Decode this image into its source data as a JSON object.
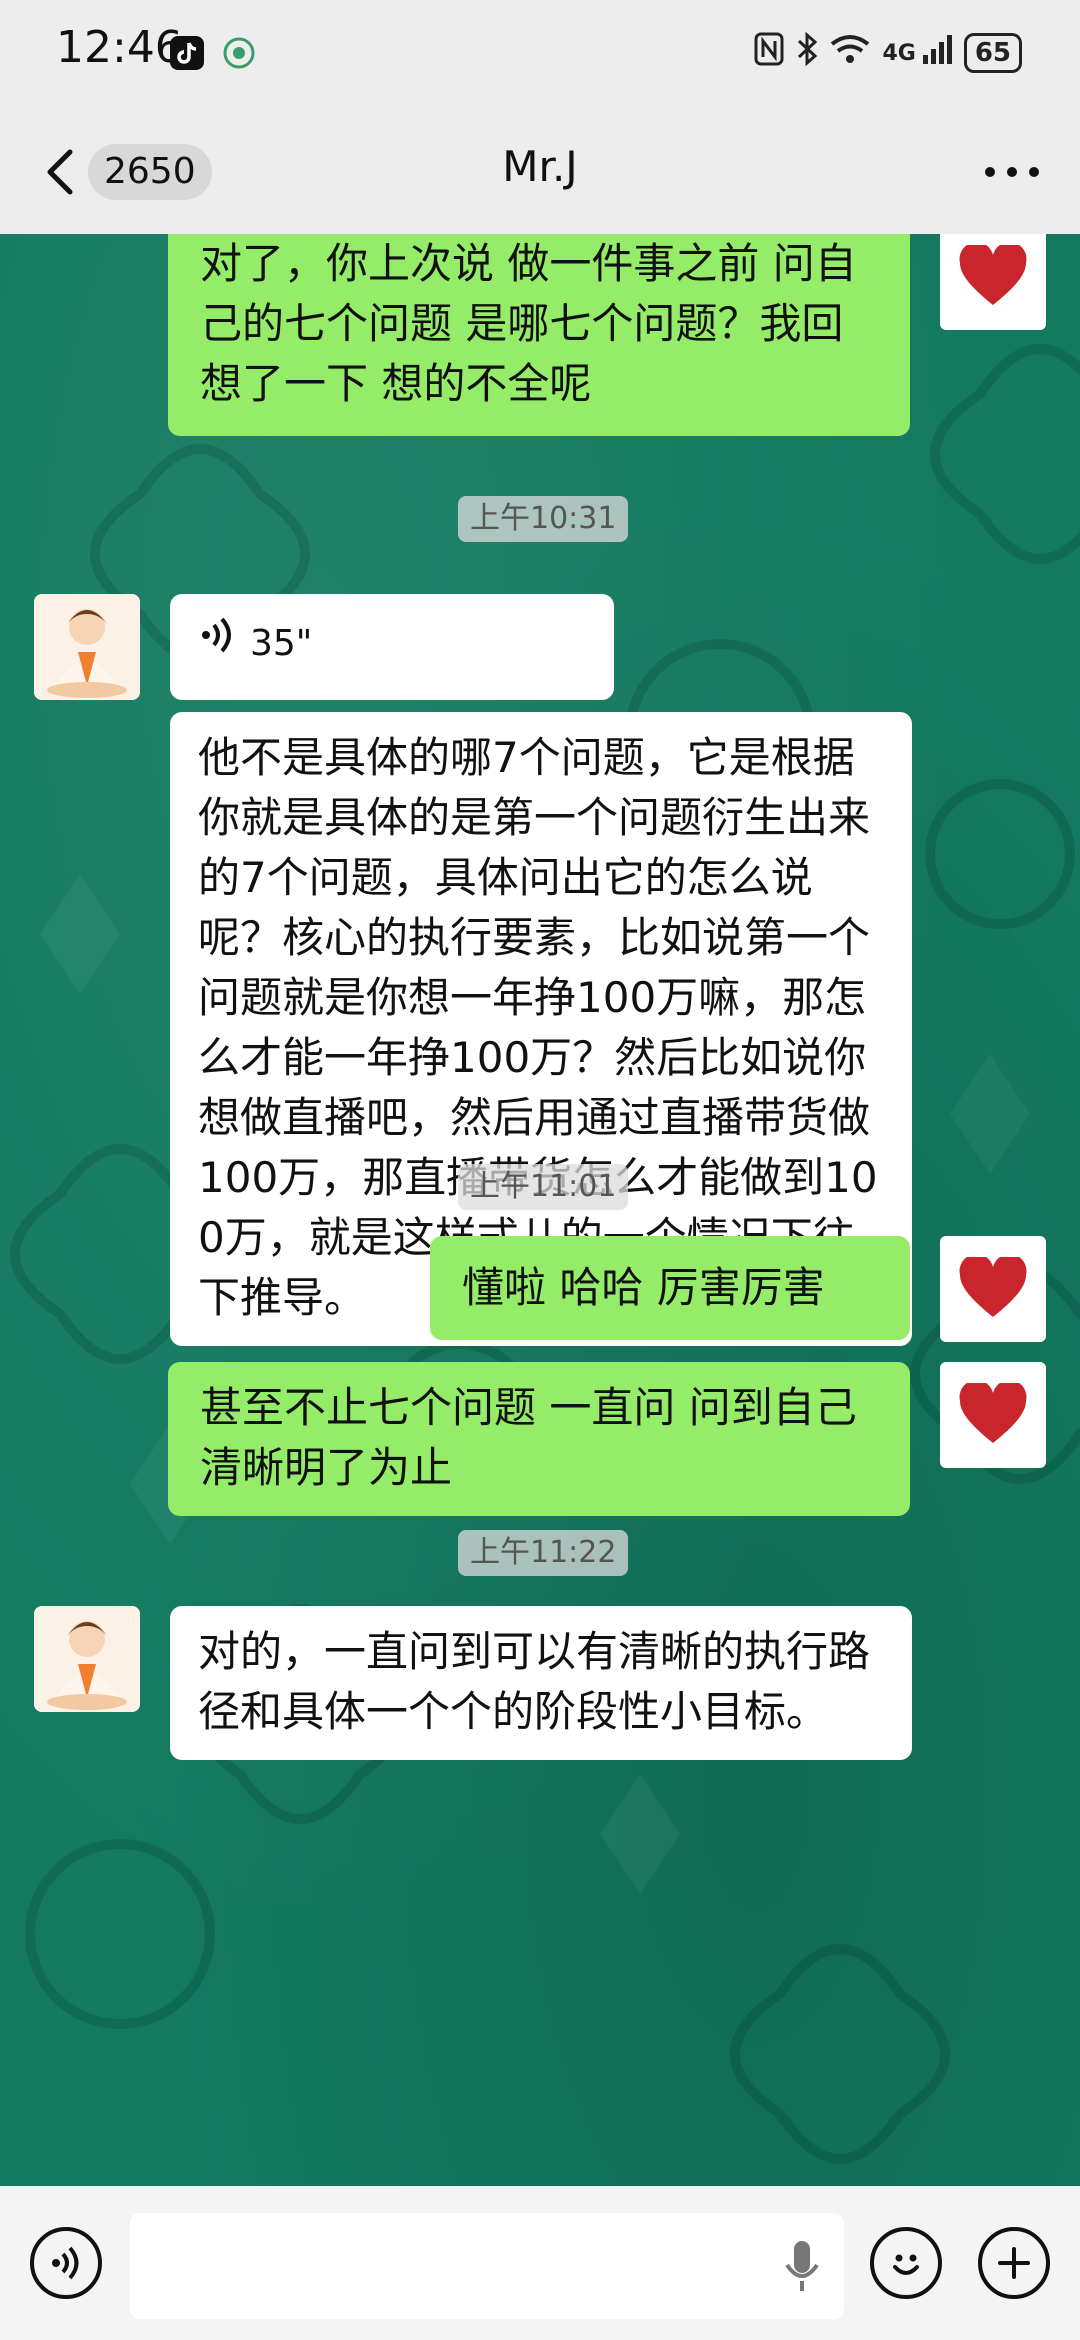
{
  "status_bar": {
    "time": "12:46",
    "network": "4G",
    "battery": "65"
  },
  "header": {
    "back_count": "2650",
    "chat_title": "Mr.J",
    "more_icon": "more-icon"
  },
  "messages": [
    {
      "type": "text",
      "direction": "outgoing",
      "text": "对了，你上次说 做一件事之前 问自己的七个问题  是哪七个问题？我回想了一下 想的不全呢"
    },
    {
      "type": "time",
      "text": "上午10:31"
    },
    {
      "type": "voice",
      "direction": "incoming",
      "duration": "35\""
    },
    {
      "type": "text",
      "direction": "incoming",
      "text": "他不是具体的哪7个问题，它是根据你就是具体的是第一个问题衍生出来的7个问题，具体问出它的怎么说呢？核心的执行要素，比如说第一个问题就是你想一年挣100万嘛，那怎么才能一年挣100万？然后比如说你想做直播吧，然后用通过直播带货做100万，那直播带货怎么才能做到100万，就是这样式儿的一个情况下往下推导。"
    },
    {
      "type": "time",
      "text": "上午11:01"
    },
    {
      "type": "text",
      "direction": "outgoing",
      "text": "懂啦 哈哈   厉害厉害"
    },
    {
      "type": "text",
      "direction": "outgoing",
      "text": "甚至不止七个问题  一直问 问到自己清晰明了为止"
    },
    {
      "type": "time",
      "text": "上午11:22"
    },
    {
      "type": "text",
      "direction": "incoming",
      "text": "对的，一直问到可以有清晰的执行路径和具体一个个的阶段性小目标。"
    }
  ],
  "colors": {
    "outgoing_bubble": "#95ec69",
    "incoming_bubble": "#ffffff",
    "wallpaper": "#137a60",
    "heart": "#c8262c"
  },
  "input_bar": {
    "voice_icon": "voice-icon",
    "mic_icon": "mic-icon",
    "emoji_icon": "emoji-icon",
    "plus_icon": "plus-icon"
  }
}
